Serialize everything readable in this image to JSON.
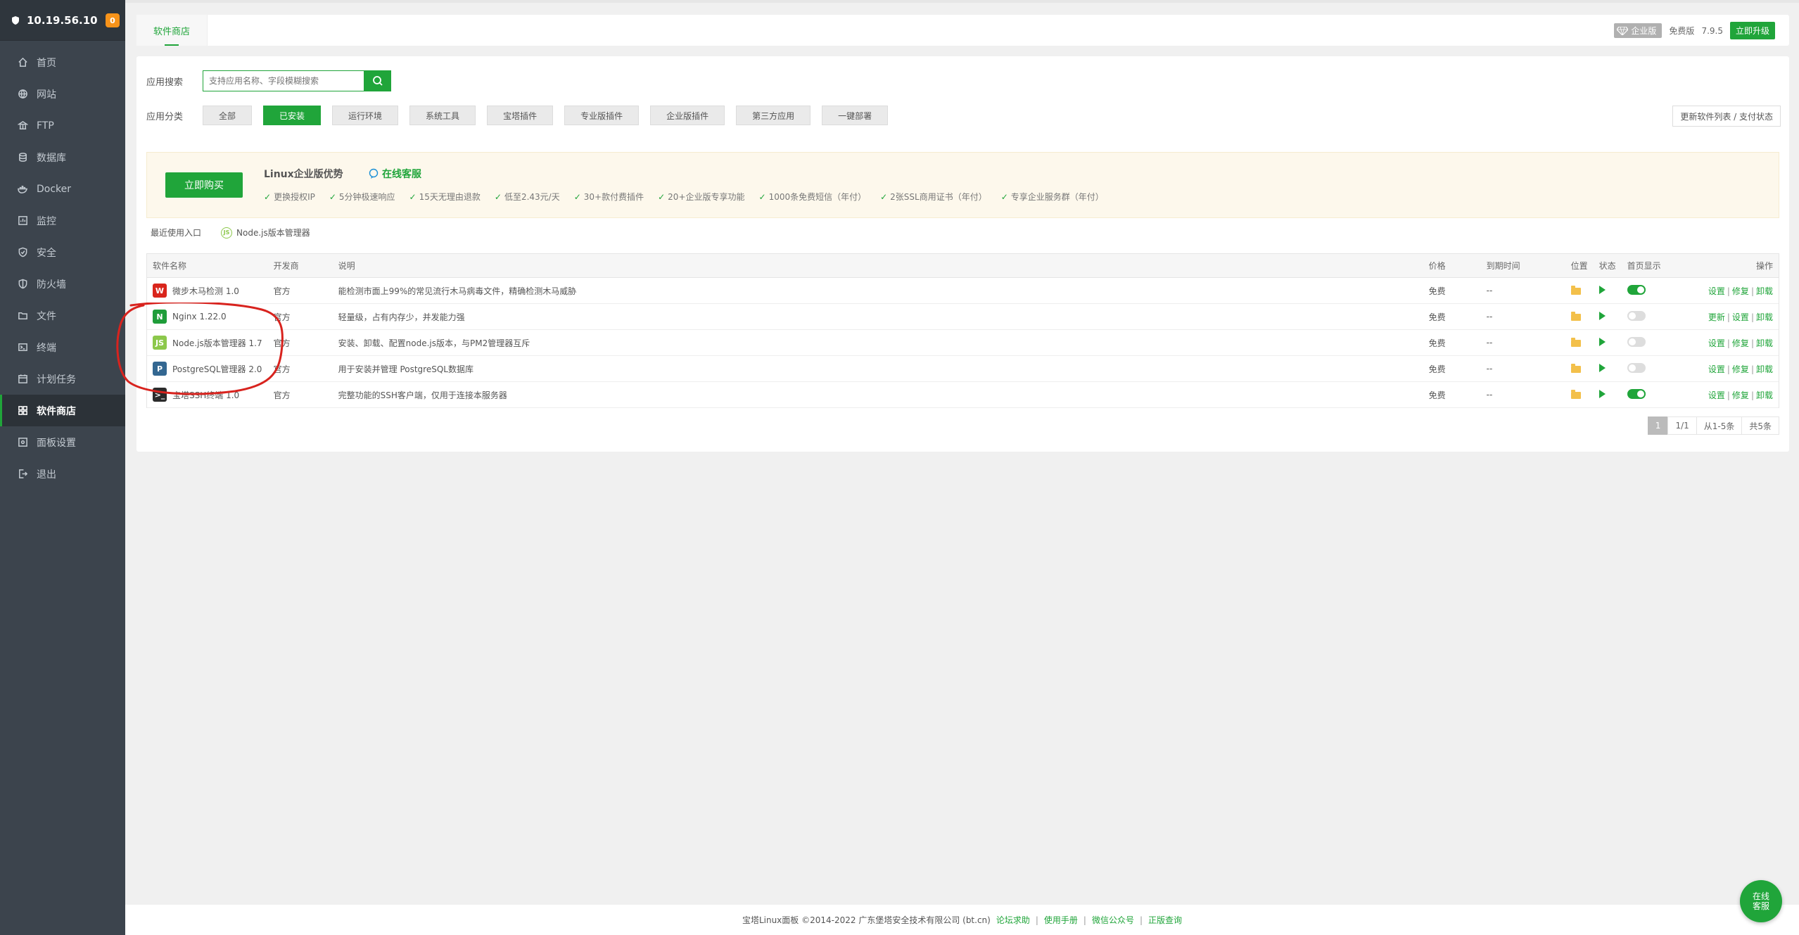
{
  "sidebar": {
    "server_ip": "10.19.56.10",
    "badge_count": "0",
    "items": [
      {
        "label": "首页",
        "icon": "home-icon"
      },
      {
        "label": "网站",
        "icon": "globe-icon"
      },
      {
        "label": "FTP",
        "icon": "ftp-icon"
      },
      {
        "label": "数据库",
        "icon": "database-icon"
      },
      {
        "label": "Docker",
        "icon": "docker-icon"
      },
      {
        "label": "监控",
        "icon": "monitor-icon"
      },
      {
        "label": "安全",
        "icon": "shield-icon"
      },
      {
        "label": "防火墙",
        "icon": "firewall-icon"
      },
      {
        "label": "文件",
        "icon": "folder-icon"
      },
      {
        "label": "终端",
        "icon": "terminal-icon"
      },
      {
        "label": "计划任务",
        "icon": "calendar-icon"
      },
      {
        "label": "软件商店",
        "icon": "grid-icon",
        "active": true
      },
      {
        "label": "面板设置",
        "icon": "settings-icon"
      },
      {
        "label": "退出",
        "icon": "logout-icon"
      }
    ]
  },
  "topbar": {
    "tab_label": "软件商店",
    "enterprise_label": "企业版",
    "edition": "免费版",
    "version": "7.9.5",
    "upgrade_label": "立即升级"
  },
  "search": {
    "label": "应用搜索",
    "placeholder": "支持应用名称、字段模糊搜索"
  },
  "categories": {
    "label": "应用分类",
    "items": [
      "全部",
      "已安装",
      "运行环境",
      "系统工具",
      "宝塔插件",
      "专业版插件",
      "企业版插件",
      "第三方应用",
      "一键部署"
    ],
    "active_index": 1,
    "refresh_label": "更新软件列表 / 支付状态"
  },
  "promo": {
    "buy_label": "立即购买",
    "title": "Linux企业版优势",
    "cs_label": "在线客服",
    "features": [
      "更换授权IP",
      "5分钟极速响应",
      "15天无理由退款",
      "低至2.43元/天",
      "30+款付费插件",
      "20+企业版专享功能",
      "1000条免费短信（年付）",
      "2张SSL商用证书（年付）",
      "专享企业服务群（年付）"
    ]
  },
  "recent": {
    "label": "最近使用入口",
    "item": "Node.js版本管理器"
  },
  "table": {
    "headers": {
      "name": "软件名称",
      "dev": "开发商",
      "desc": "说明",
      "price": "价格",
      "expire": "到期时间",
      "loc": "位置",
      "status": "状态",
      "home": "首页显示",
      "ops": "操作"
    },
    "rows": [
      {
        "name": "微步木马检测 1.0",
        "dev": "官方",
        "desc": "能检测市面上99%的常见流行木马病毒文件，精确检测木马威胁",
        "price": "免费",
        "expire": "--",
        "home_on": true,
        "op1": "设置",
        "op2": "修复",
        "op3": "卸载",
        "icon_letter": "W",
        "icon_bg": "#d9251c"
      },
      {
        "name": "Nginx 1.22.0",
        "dev": "官方",
        "desc": "轻量级，占有内存少，并发能力强",
        "price": "免费",
        "expire": "--",
        "home_on": false,
        "op1": "更新",
        "op2": "设置",
        "op3": "卸载",
        "icon_letter": "N",
        "icon_bg": "#1f9d3a"
      },
      {
        "name": "Node.js版本管理器 1.7",
        "dev": "官方",
        "desc": "安装、卸载、配置node.js版本，与PM2管理器互斥",
        "price": "免费",
        "expire": "--",
        "home_on": false,
        "op1": "设置",
        "op2": "修复",
        "op3": "卸载",
        "icon_letter": "JS",
        "icon_bg": "#8cc84b"
      },
      {
        "name": "PostgreSQL管理器 2.0",
        "dev": "官方",
        "desc": "用于安装并管理 PostgreSQL数据库",
        "price": "免费",
        "expire": "--",
        "home_on": false,
        "op1": "设置",
        "op2": "修复",
        "op3": "卸载",
        "icon_letter": "P",
        "icon_bg": "#336791"
      },
      {
        "name": "宝塔SSH终端 1.0",
        "dev": "官方",
        "desc": "完整功能的SSH客户端，仅用于连接本服务器",
        "price": "免费",
        "expire": "--",
        "home_on": true,
        "op1": "设置",
        "op2": "修复",
        "op3": "卸载",
        "icon_letter": ">_",
        "icon_bg": "#2b2b2b"
      }
    ]
  },
  "pager": {
    "current": "1",
    "pages": "1/1",
    "range": "从1-5条",
    "total": "共5条"
  },
  "footer": {
    "copyright": "宝塔Linux面板 ©2014-2022 广东堡塔安全技术有限公司 (bt.cn)",
    "links": [
      "论坛求助",
      "使用手册",
      "微信公众号",
      "正版查询"
    ]
  },
  "chat": {
    "line1": "在线",
    "line2": "客服"
  },
  "colors": {
    "accent": "#20a53a",
    "sidebar_bg": "#3c444d",
    "annotation": "#d8231e"
  }
}
